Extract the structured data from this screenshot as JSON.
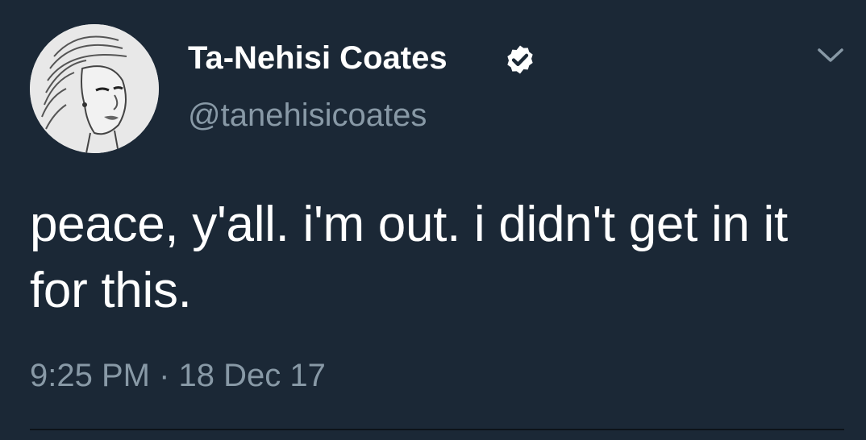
{
  "author": {
    "display_name": "Ta-Nehisi Coates",
    "handle": "@tanehisicoates",
    "verified": true
  },
  "tweet": {
    "text": "peace, y'all. i'm out. i didn't get in it for this.",
    "time": "9:25 PM",
    "separator": "·",
    "date": "18 Dec 17"
  },
  "icons": {
    "verified": "verified-badge-icon",
    "menu": "chevron-down-icon"
  },
  "colors": {
    "background": "#1b2836",
    "primary_text": "#ffffff",
    "secondary_text": "#8899a6"
  }
}
